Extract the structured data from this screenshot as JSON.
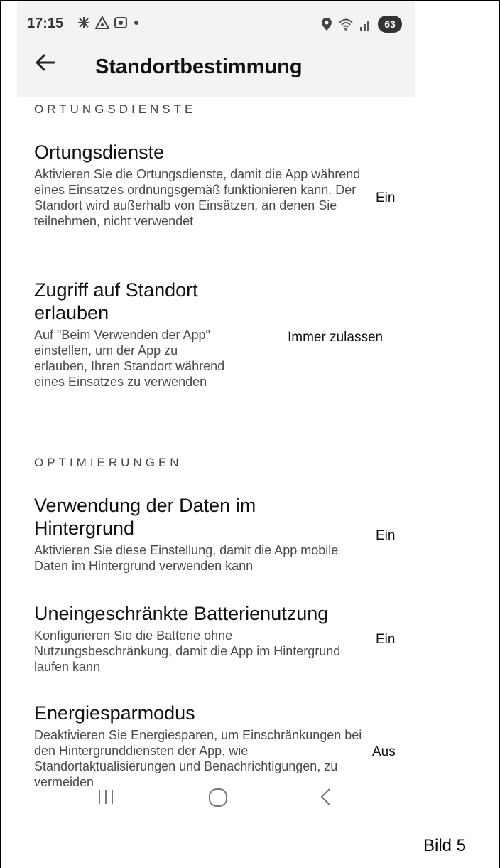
{
  "status_bar": {
    "time": "17:15",
    "battery": "63",
    "icons_left": [
      "asterisk-icon",
      "alert-triangle-icon",
      "screen-record-icon",
      "dot-icon"
    ],
    "icons_right": [
      "location-pin-icon",
      "wifi-icon",
      "signal-icon",
      "battery-icon"
    ]
  },
  "app_bar": {
    "title": "Standortbestimmung",
    "back_icon": "arrow-left-icon"
  },
  "sections": [
    {
      "header": "ORTUNGSDIENSTE",
      "items": [
        {
          "title": "Ortungsdienste",
          "description": "Aktivieren Sie die Ortungsdienste, damit die App während eines Einsatzes ordnungsgemäß funktionieren kann. Der Standort wird außerhalb von Einsätzen, an denen Sie teilnehmen, nicht verwendet",
          "value": "Ein"
        },
        {
          "title": "Zugriff auf Standort erlauben",
          "description": "Auf \"Beim Verwenden der App\" einstellen, um der App zu erlauben, Ihren Standort während eines Einsatzes zu verwenden",
          "value": "Immer zulassen"
        }
      ]
    },
    {
      "header": "OPTIMIERUNGEN",
      "items": [
        {
          "title": "Verwendung der Daten im Hintergrund",
          "description": "Aktivieren Sie diese Einstellung, damit die App mobile Daten im Hintergrund verwenden kann",
          "value": "Ein"
        },
        {
          "title": "Uneingeschränkte Batterienutzung",
          "description": "Konfigurieren Sie die Batterie ohne Nutzungsbeschränkung, damit die App im Hintergrund laufen kann",
          "value": "Ein"
        },
        {
          "title": "Energiesparmodus",
          "description": "Deaktivieren Sie Energiesparen, um Einschränkungen bei den Hintergrunddiensten der App, wie Standortaktualisierungen und Benachrichtigungen, zu vermeiden",
          "value": "Aus"
        }
      ]
    }
  ],
  "nav_bar": [
    "recent-apps-icon",
    "home-icon",
    "back-icon"
  ],
  "caption": "Bild 5"
}
